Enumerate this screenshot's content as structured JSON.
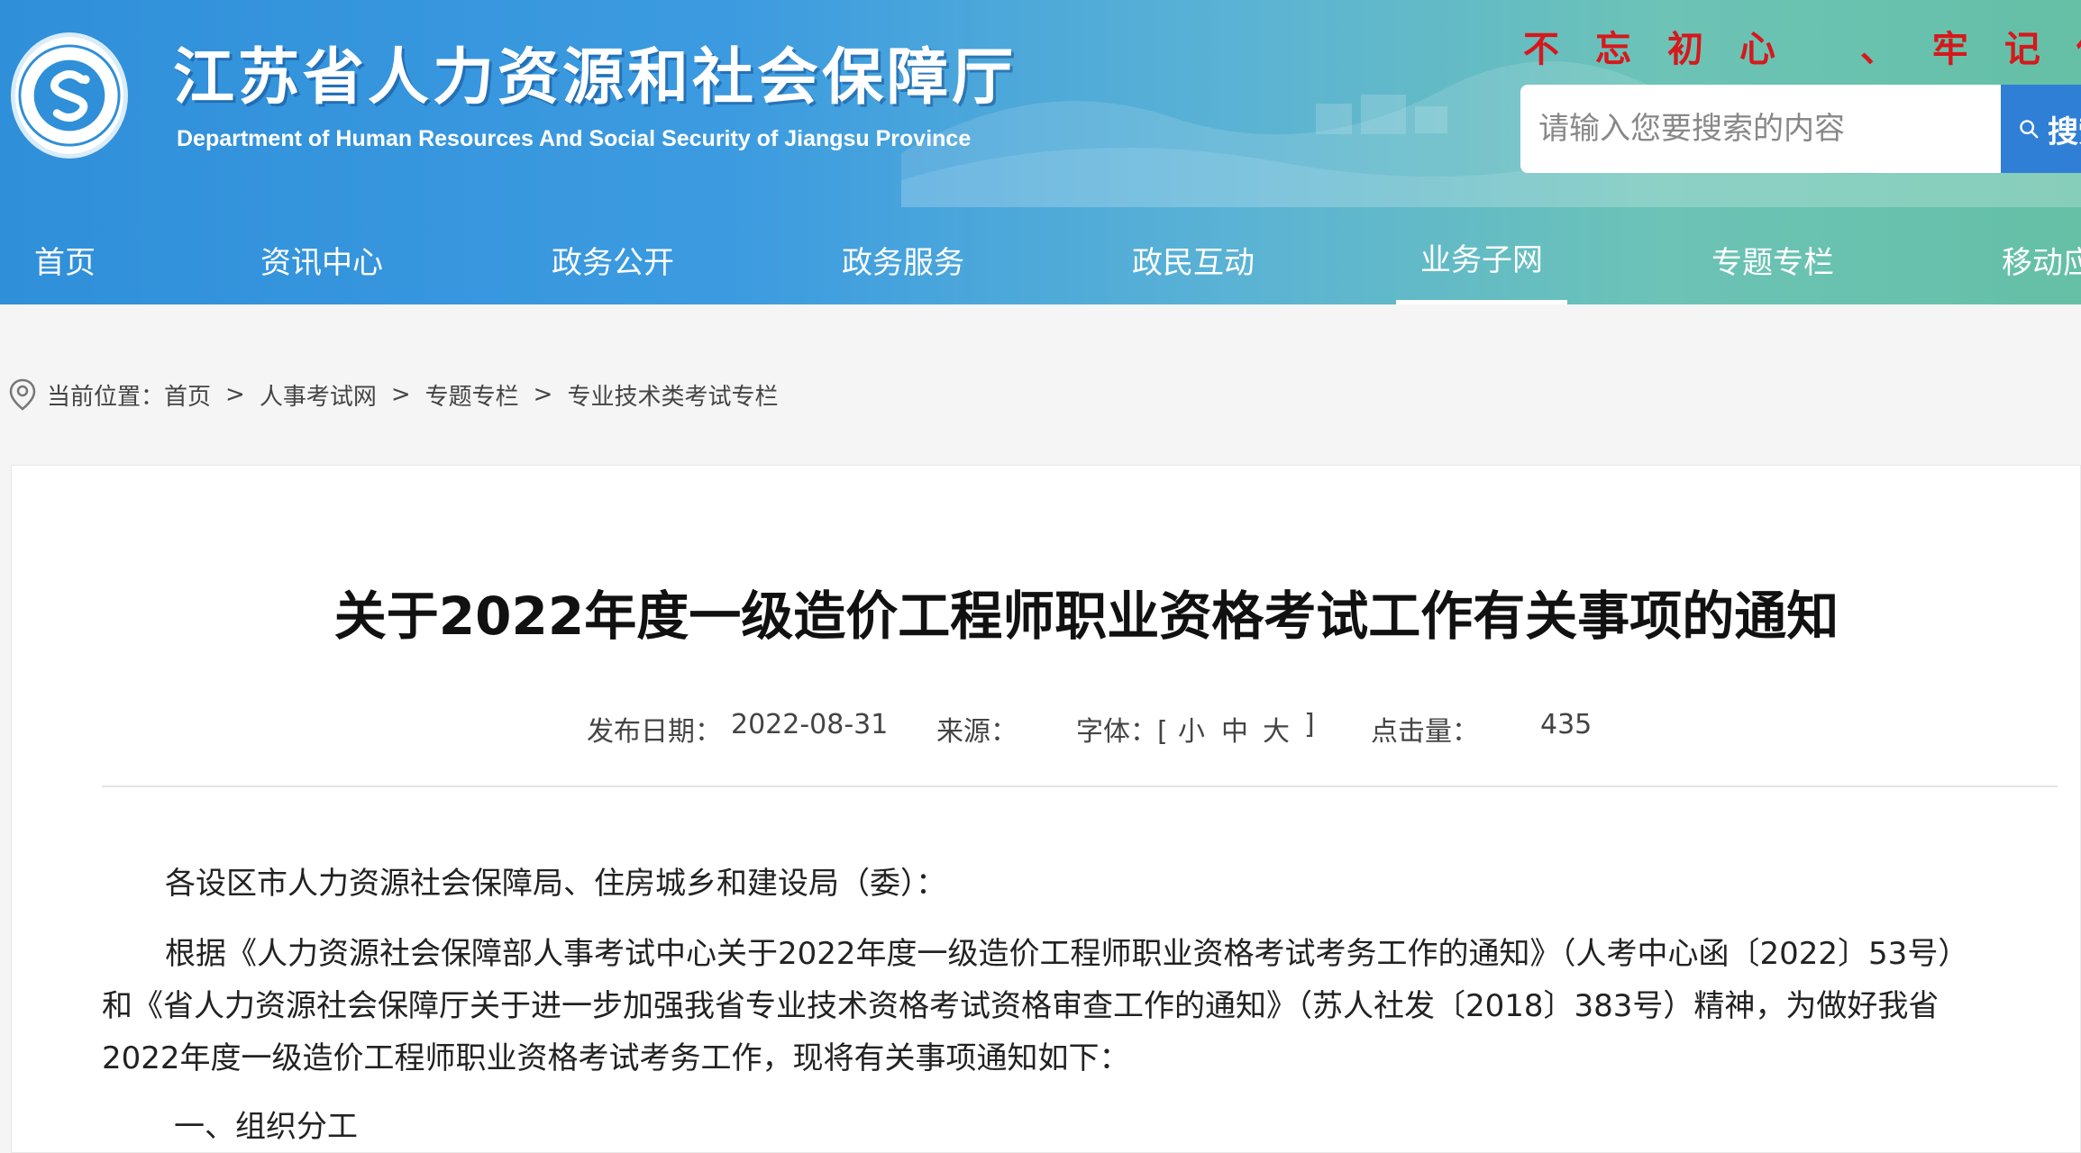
{
  "header": {
    "logo_text": "江苏省人力资源和社会保障厅",
    "title": "江苏省人力资源和社会保障厅",
    "subtitle": "Department of Human Resources And Social Security of Jiangsu Province",
    "slogan": "不忘初心 、牢记使命",
    "search": {
      "placeholder": "请输入您要搜索的内容",
      "button_label": "搜索",
      "button_icon": "search-icon"
    },
    "colors": {
      "header_start": "#2f8fd9",
      "header_end": "#65c0a6",
      "slogan": "#d6181c",
      "search_button": "#2f7fd6"
    }
  },
  "nav": {
    "items": [
      {
        "label": "首页"
      },
      {
        "label": "资讯中心"
      },
      {
        "label": "政务公开"
      },
      {
        "label": "政务服务"
      },
      {
        "label": "政民互动"
      },
      {
        "label": "业务子网"
      },
      {
        "label": "专题专栏"
      },
      {
        "label": "移动应用"
      }
    ],
    "active": "业务子网"
  },
  "breadcrumb": {
    "icon": "location-pin-icon",
    "prefix": "当前位置：",
    "items": [
      "首页",
      "人事考试网",
      "专题专栏",
      "专业技术类考试专栏"
    ],
    "separator": ">"
  },
  "article": {
    "title": "关于2022年度一级造价工程师职业资格考试工作有关事项的通知",
    "meta": {
      "date_label": "发布日期：",
      "date": "2022-08-31",
      "source_label": "来源：",
      "font_label": "字体：[",
      "font_small": "小",
      "font_medium": "中",
      "font_large": "大",
      "font_close": "]",
      "clicks_label": "点击量：",
      "clicks": "435"
    },
    "salutation": "各设区市人力资源社会保障局、住房城乡和建设局（委）：",
    "para1_line1": "根据《人力资源社会保障部人事考试中心关于2022年度一级造价工程师职业资格考试考务工作的通知》（人考中心函〔2022〕53号）",
    "para1_line2": "和《省人力资源社会保障厅关于进一步加强我省专业技术资格考试资格审查工作的通知》（苏人社发〔2018〕383号）精神，为做好我省",
    "para1_line3": "2022年度一级造价工程师职业资格考试考务工作，现将有关事项通知如下：",
    "section1": "一、组织分工"
  }
}
